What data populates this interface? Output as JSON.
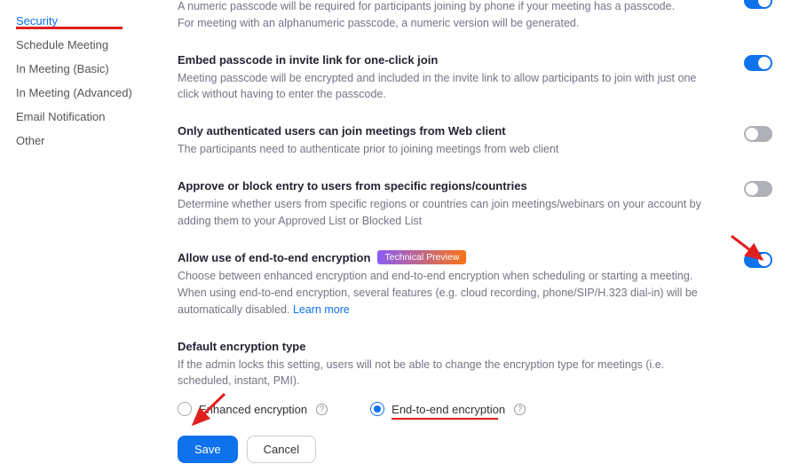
{
  "sidebar": {
    "items": [
      {
        "label": "Security",
        "active": true
      },
      {
        "label": "Schedule Meeting",
        "active": false
      },
      {
        "label": "In Meeting (Basic)",
        "active": false
      },
      {
        "label": "In Meeting (Advanced)",
        "active": false
      },
      {
        "label": "Email Notification",
        "active": false
      },
      {
        "label": "Other",
        "active": false
      }
    ]
  },
  "settings": {
    "waiting_passcode": {
      "desc": "A numeric passcode will be required for participants joining by phone if your meeting has a passcode. For meeting with an alphanumeric passcode, a numeric version will be generated.",
      "toggle": "on"
    },
    "embed_passcode": {
      "title": "Embed passcode in invite link for one-click join",
      "desc": "Meeting passcode will be encrypted and included in the invite link to allow participants to join with just one click without having to enter the passcode.",
      "toggle": "on"
    },
    "auth_users": {
      "title": "Only authenticated users can join meetings from Web client",
      "desc": "The participants need to authenticate prior to joining meetings from web client",
      "toggle": "off"
    },
    "regions": {
      "title": "Approve or block entry to users from specific regions/countries",
      "desc": "Determine whether users from specific regions or countries can join meetings/webinars on your account by adding them to your Approved List or Blocked List",
      "toggle": "off"
    },
    "e2e": {
      "title": "Allow use of end-to-end encryption",
      "badge": "Technical Preview",
      "desc": "Choose between enhanced encryption and end-to-end encryption when scheduling or starting a meeting. When using end-to-end encryption, several features (e.g. cloud recording, phone/SIP/H.323 dial-in) will be automatically disabled. ",
      "learn_more": "Learn more",
      "toggle": "on"
    },
    "default_enc": {
      "title": "Default encryption type",
      "desc": "If the admin locks this setting, users will not be able to change the encryption type for meetings (i.e. scheduled, instant, PMI).",
      "options": {
        "enhanced": "Enhanced encryption",
        "e2e": "End-to-end encryption"
      },
      "selected": "e2e"
    }
  },
  "buttons": {
    "save": "Save",
    "cancel": "Cancel"
  }
}
